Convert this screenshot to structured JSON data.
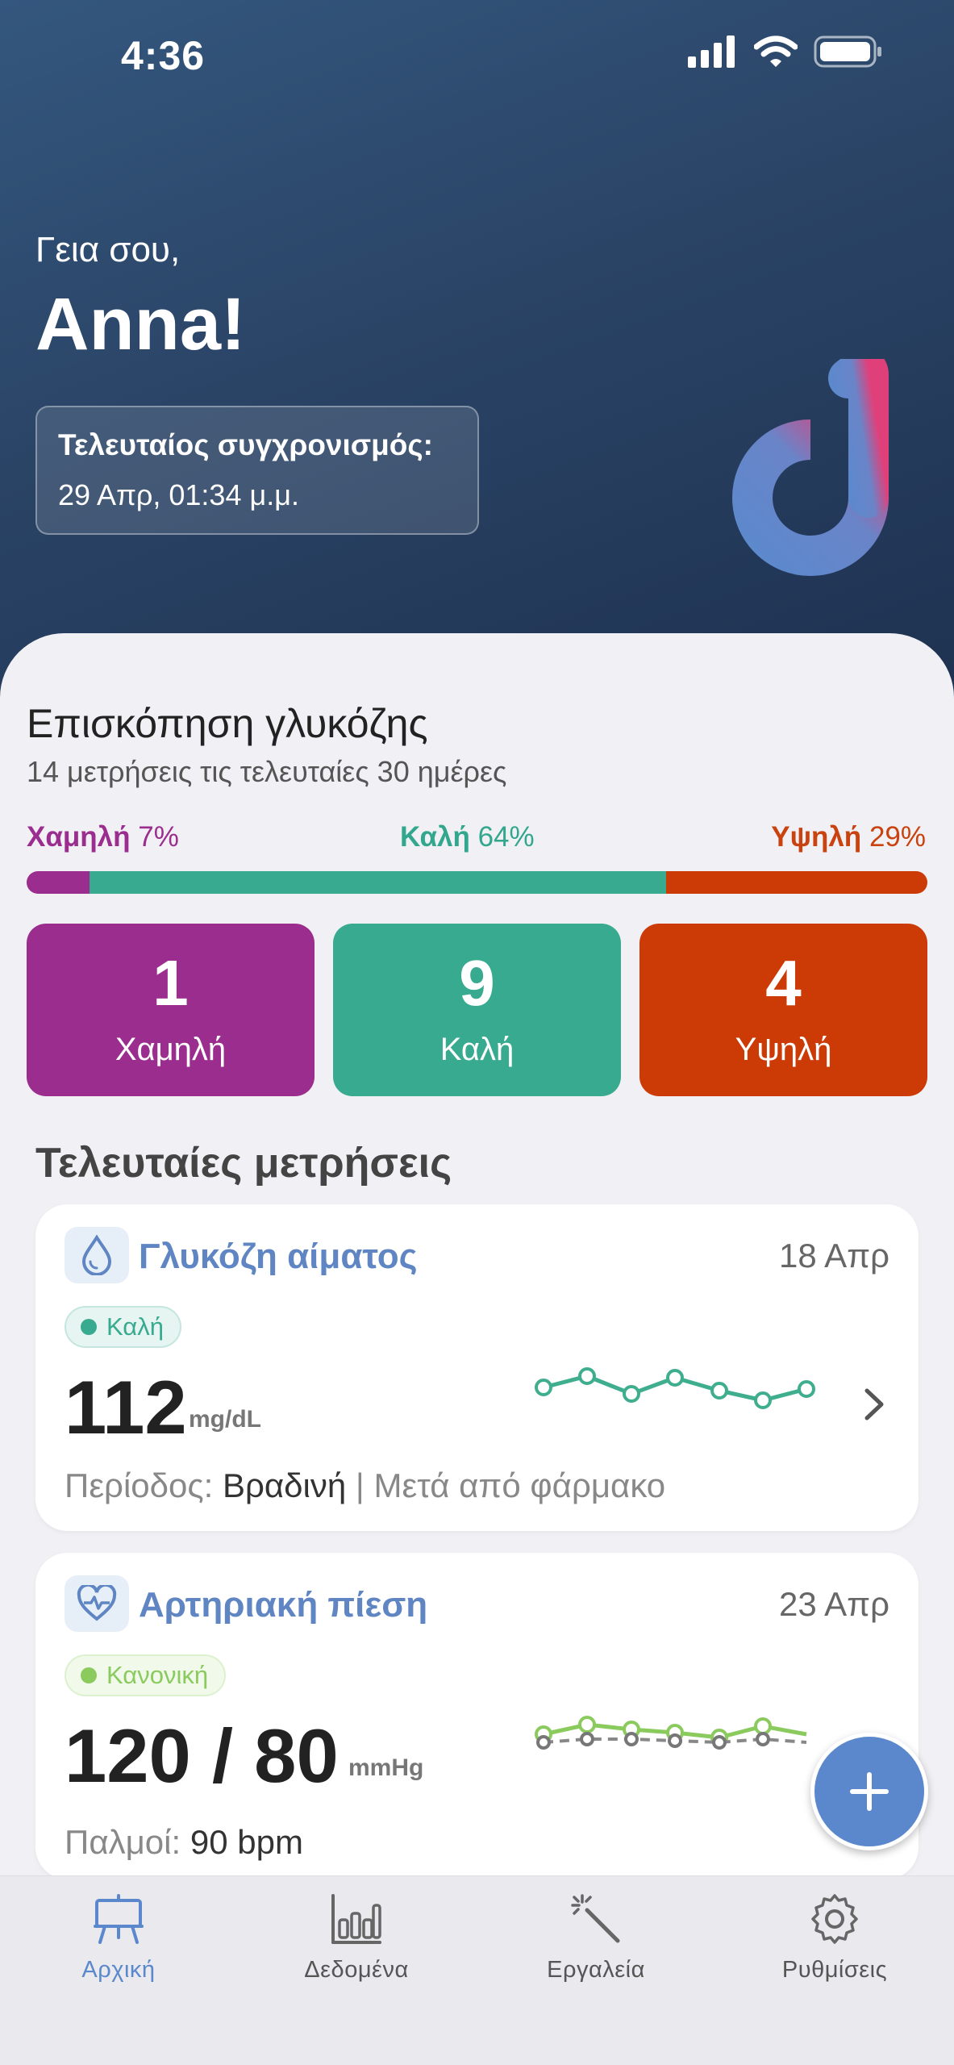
{
  "status_bar": {
    "time": "4:36"
  },
  "hero": {
    "greeting": "Γεια σου,",
    "user_name": "Anna!",
    "sync_title": "Τελευταίος συγχρονισμός:",
    "sync_date": "29 Απρ, 01:34 μ.μ."
  },
  "overview": {
    "title": "Επισκόπηση γλυκόζης",
    "subtitle": "14 μετρήσεις τις τελευταίες 30 ημέρες",
    "ranges": [
      {
        "label": "Χαμηλή",
        "percent": "7%",
        "fraction": 0.07,
        "color": "#9b2d8f",
        "count": "1"
      },
      {
        "label": "Καλή",
        "percent": "64%",
        "fraction": 0.64,
        "color": "#37aa90",
        "count": "9"
      },
      {
        "label": "Υψηλή",
        "percent": "29%",
        "fraction": 0.29,
        "color": "#cc3b06",
        "count": "4"
      }
    ]
  },
  "recent": {
    "title": "Τελευταίες μετρήσεις",
    "cards": [
      {
        "icon": "drop-icon",
        "title": "Γλυκόζη αίματος",
        "date": "18 Απρ",
        "status": "Καλή",
        "status_color": "#37aa90",
        "value": "112",
        "unit": "mg/dL",
        "foot_label": "Περίοδος:",
        "foot_value": "Βραδινή",
        "foot_extra": "| Μετά από φάρμακο"
      },
      {
        "icon": "heart-pulse-icon",
        "title": "Αρτηριακή πίεση",
        "date": "23 Απρ",
        "status": "Κανονική",
        "status_color": "#8bcb5e",
        "value": "120 / 80",
        "unit": "mmHg",
        "foot_label": "Παλμοί:",
        "foot_value": "90 bpm"
      }
    ]
  },
  "tabs": [
    {
      "label": "Αρχική",
      "icon": "easel-icon",
      "active": true
    },
    {
      "label": "Δεδομένα",
      "icon": "bar-chart-icon",
      "active": false
    },
    {
      "label": "Εργαλεία",
      "icon": "magic-wand-icon",
      "active": false
    },
    {
      "label": "Ρυθμίσεις",
      "icon": "gear-icon",
      "active": false
    }
  ],
  "colors": {
    "accent": "#5b88cc",
    "hero_top": "#34577e",
    "hero_bottom": "#1e3150"
  }
}
